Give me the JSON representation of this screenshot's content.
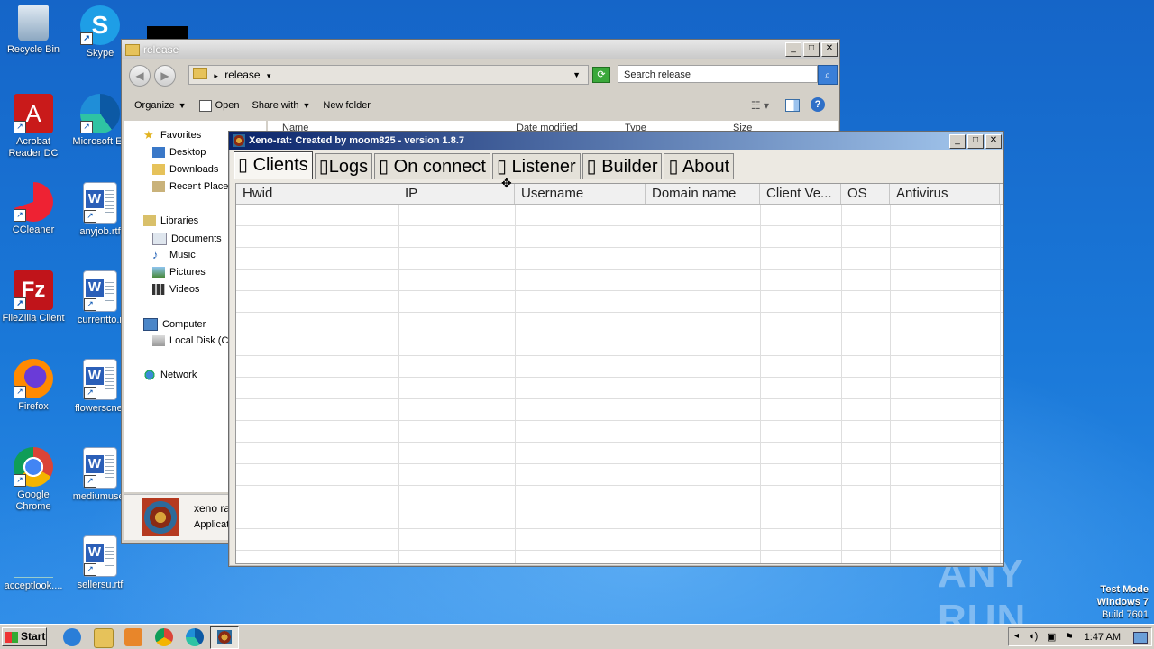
{
  "desktop": {
    "icons": [
      {
        "label": "Recycle Bin"
      },
      {
        "label": "Skype"
      },
      {
        "label": "Acrobat Reader DC"
      },
      {
        "label": "Microsoft Ed"
      },
      {
        "label": "CCleaner"
      },
      {
        "label": "anyjob.rtf"
      },
      {
        "label": "FileZilla Client"
      },
      {
        "label": "currentto.r"
      },
      {
        "label": "Firefox"
      },
      {
        "label": "flowerscnet"
      },
      {
        "label": "Google Chrome"
      },
      {
        "label": "mediumuser"
      },
      {
        "label": "acceptlook...."
      },
      {
        "label": "sellersu.rtf"
      }
    ]
  },
  "explorer": {
    "title": "release",
    "address": "release",
    "search_placeholder": "Search release",
    "commands": {
      "organize": "Organize",
      "open": "Open",
      "share": "Share with",
      "newfolder": "New folder"
    },
    "nav": {
      "favorites": "Favorites",
      "desktop": "Desktop",
      "downloads": "Downloads",
      "recent": "Recent Places",
      "libraries": "Libraries",
      "documents": "Documents",
      "music": "Music",
      "pictures": "Pictures",
      "videos": "Videos",
      "computer": "Computer",
      "localdisk": "Local Disk (C:",
      "network": "Network"
    },
    "columns": {
      "name": "Name",
      "date": "Date modified",
      "type": "Type",
      "size": "Size"
    },
    "details": {
      "name": "xeno ra",
      "type": "Applicat"
    }
  },
  "xeno": {
    "title": "Xeno-rat: Created by moom825 - version 1.8.7",
    "tabs": [
      "▯ Clients",
      "▯Logs",
      "▯ On connect",
      "▯ Listener",
      "▯ Builder",
      "▯ About"
    ],
    "columns": [
      "Hwid",
      "IP",
      "Username",
      "Domain name",
      "Client Ve...",
      "OS",
      "Antivirus"
    ]
  },
  "taskbar": {
    "start": "Start",
    "clock": "1:47 AM"
  },
  "overlay": {
    "watermark": "ANY RUN",
    "testmode_1": "Test Mode",
    "testmode_2": "Windows 7",
    "testmode_3": "Build 7601"
  }
}
